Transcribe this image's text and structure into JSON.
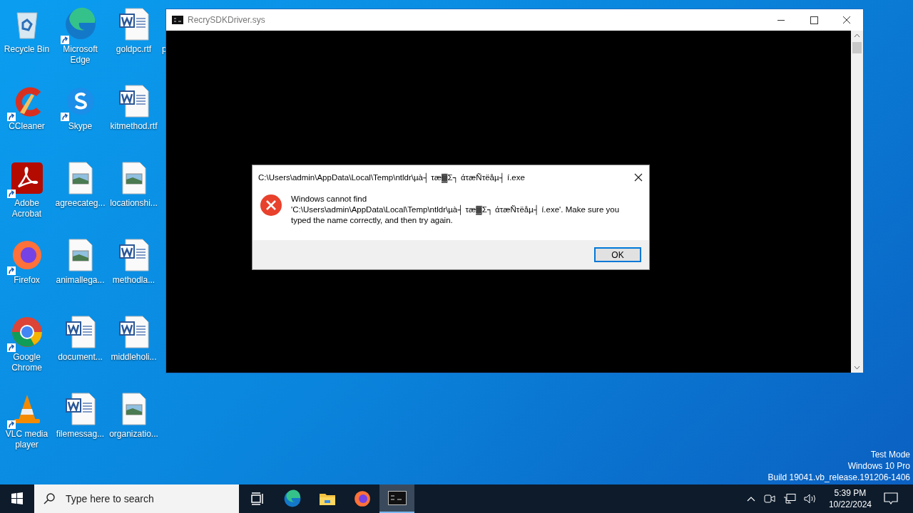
{
  "desktop": {
    "columns": [
      [
        {
          "label": "Recycle Bin",
          "kind": "recycle",
          "shortcut": false
        },
        {
          "label": "CCleaner",
          "kind": "ccleaner",
          "shortcut": true
        },
        {
          "label": "Adobe Acrobat",
          "kind": "acrobat",
          "shortcut": true
        },
        {
          "label": "Firefox",
          "kind": "firefox",
          "shortcut": true
        },
        {
          "label": "Google Chrome",
          "kind": "chrome",
          "shortcut": true
        },
        {
          "label": "VLC media player",
          "kind": "vlc",
          "shortcut": true
        }
      ],
      [
        {
          "label": "Microsoft Edge",
          "kind": "edge",
          "shortcut": true
        },
        {
          "label": "Skype",
          "kind": "skype",
          "shortcut": true
        },
        {
          "label": "agreecateg...",
          "kind": "image",
          "shortcut": false
        },
        {
          "label": "animallega...",
          "kind": "image",
          "shortcut": false
        },
        {
          "label": "document...",
          "kind": "word",
          "shortcut": false
        },
        {
          "label": "filemessag...",
          "kind": "word",
          "shortcut": false
        }
      ],
      [
        {
          "label": "goldpc.rtf",
          "kind": "word",
          "shortcut": false
        },
        {
          "label": "kitmethod.rtf",
          "kind": "word",
          "shortcut": false
        },
        {
          "label": "locationshi...",
          "kind": "image",
          "shortcut": false
        },
        {
          "label": "methodla...",
          "kind": "word",
          "shortcut": false
        },
        {
          "label": "middleholi...",
          "kind": "word",
          "shortcut": false
        },
        {
          "label": "organizatio...",
          "kind": "image",
          "shortcut": false
        }
      ],
      [
        {
          "label": "p",
          "kind": "hidden"
        }
      ]
    ],
    "system_text": [
      "Test Mode",
      "Windows 10 Pro",
      "Build 19041.vb_release.191206-1406"
    ]
  },
  "console_window": {
    "title": "RecrySDKDriver.sys"
  },
  "dialog": {
    "title": "C:\\Users\\admin\\AppData\\Local\\Temp\\ntldr\\µà┤ τæ▓Σ┐ άτæÑτëåµ┤ í.exe",
    "message": "Windows cannot find\n'C:\\Users\\admin\\AppData\\Local\\Temp\\ntldr\\µà┤ τæ▓Σ┐ άτæÑτëåµ┤ í.exe'. Make sure you\ntyped the name correctly, and then try again.",
    "button": "OK"
  },
  "taskbar": {
    "search": {
      "placeholder": "Type here to search"
    },
    "apps": [
      {
        "kind": "taskview",
        "active": false
      },
      {
        "kind": "edge",
        "active": false
      },
      {
        "kind": "explorer",
        "active": false
      },
      {
        "kind": "firefox",
        "active": false
      },
      {
        "kind": "console",
        "active": true
      }
    ],
    "time": "5:39 PM",
    "date": "10/22/2024"
  }
}
